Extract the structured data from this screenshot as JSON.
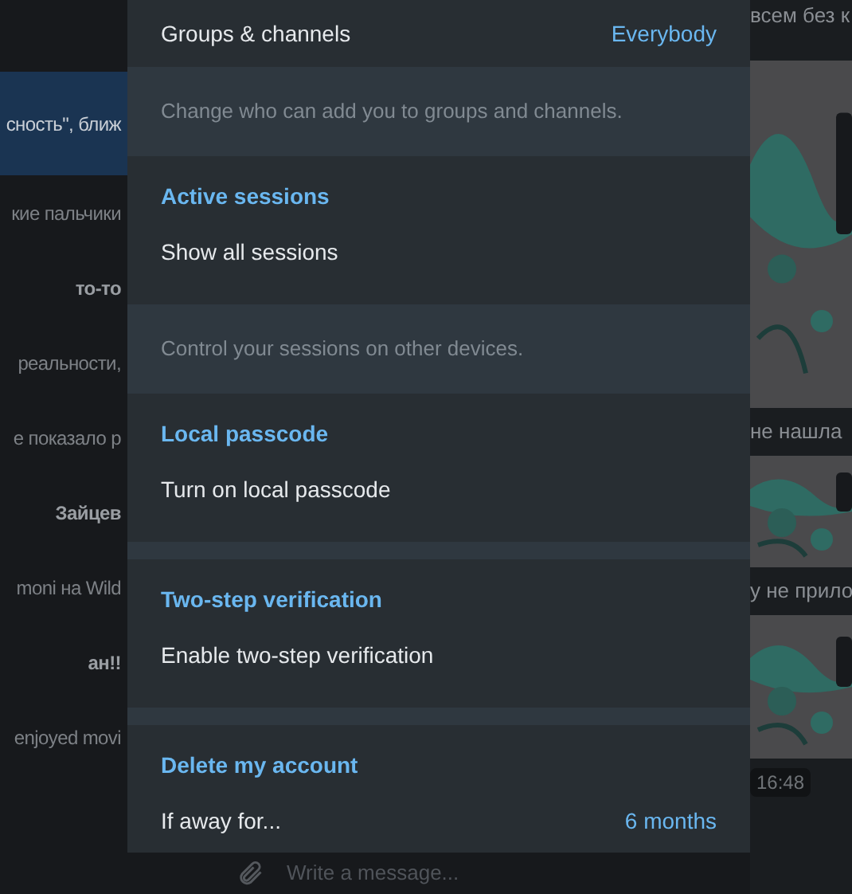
{
  "chat_list": [
    {
      "text": "сность\", ближ",
      "bold": false,
      "selected": true
    },
    {
      "text": "кие пальчики",
      "bold": false,
      "selected": false
    },
    {
      "text": "то-то",
      "bold": true,
      "selected": false
    },
    {
      "text": "реальности,",
      "bold": false,
      "selected": false
    },
    {
      "text": "е показало р",
      "bold": false,
      "selected": false
    },
    {
      "text": "Зайцев",
      "bold": true,
      "selected": false
    },
    {
      "text": "moni на Wild",
      "bold": false,
      "selected": false
    },
    {
      "text": "ан!!",
      "bold": true,
      "selected": false
    },
    {
      "text": "enjoyed movi",
      "bold": false,
      "selected": false
    }
  ],
  "chat": {
    "messages": [
      "всем без к",
      "не нашла",
      "у не прило"
    ],
    "time": "16:48"
  },
  "composer": {
    "placeholder": "Write a message..."
  },
  "settings": [
    {
      "kind": "group",
      "items": [
        {
          "label": "Groups & channels",
          "value": "Everybody"
        }
      ]
    },
    {
      "kind": "hint",
      "text": "Change who can add you to groups and channels."
    },
    {
      "kind": "group",
      "header": "Active sessions",
      "items": [
        {
          "label": "Show all sessions"
        }
      ]
    },
    {
      "kind": "hint",
      "text": "Control your sessions on other devices."
    },
    {
      "kind": "group",
      "header": "Local passcode",
      "items": [
        {
          "label": "Turn on local passcode"
        }
      ]
    },
    {
      "kind": "group",
      "header": "Two-step verification",
      "items": [
        {
          "label": "Enable two-step verification"
        }
      ]
    },
    {
      "kind": "group",
      "header": "Delete my account",
      "items": [
        {
          "label": "If away for...",
          "value": "6 months"
        }
      ]
    }
  ]
}
